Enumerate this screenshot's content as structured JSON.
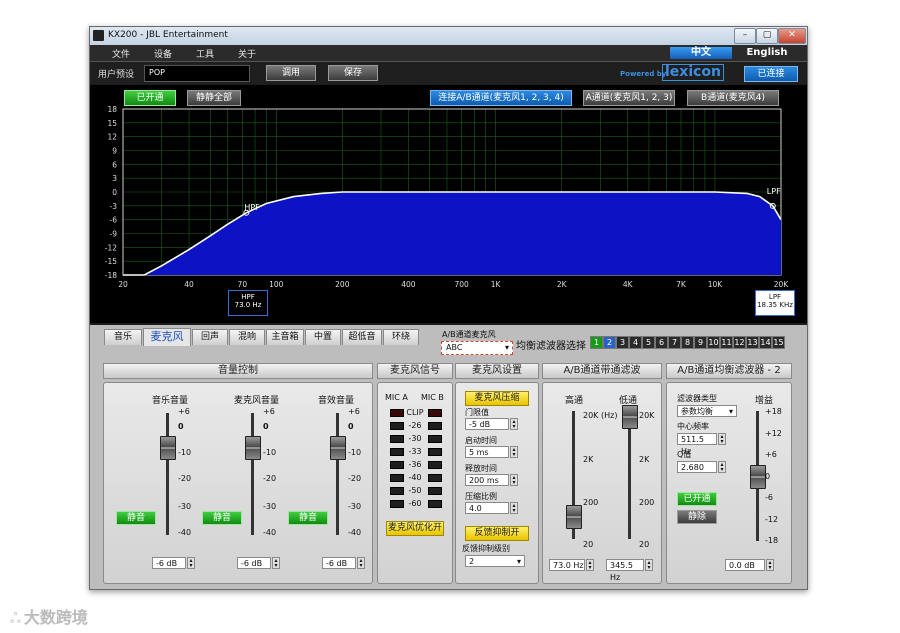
{
  "window": {
    "title": "KX200 - JBL Entertainment",
    "controls": {
      "minimize": "–",
      "maximize": "▢",
      "close": "✕"
    }
  },
  "menu": [
    "文件",
    "设备",
    "工具",
    "关于"
  ],
  "lang": {
    "zh": "中文",
    "en": "English"
  },
  "preset": {
    "label": "用户预设",
    "value": "POP",
    "recall": "调用",
    "save": "保存"
  },
  "brand": {
    "powered": "Powered by",
    "logo": "lexicon"
  },
  "connection": "已连接",
  "graph": {
    "on_button": "已开通",
    "bypass_button": "静静全部",
    "route_buttons": [
      "连接A/B通道(麦克风1, 2, 3, 4)",
      "A通道(麦克风1, 2, 3)",
      "B通道(麦克风4)"
    ],
    "hpf_label": "HPF",
    "lpf_label": "LPF",
    "hpf_box": {
      "title": "HPF",
      "value": "73.0 Hz"
    },
    "lpf_box": {
      "title": "LPF",
      "value": "18.35 KHz"
    }
  },
  "chart_data": {
    "type": "area",
    "y_ticks": [
      18,
      15,
      12,
      9,
      6,
      3,
      0,
      -3,
      -6,
      -9,
      -12,
      -15,
      -18
    ],
    "x_ticks": [
      "20",
      "40",
      "70",
      "100",
      "200",
      "400",
      "700",
      "1K",
      "2K",
      "4K",
      "7K",
      "10K",
      "20K"
    ],
    "x_tick_values": [
      20,
      40,
      70,
      100,
      200,
      400,
      700,
      1000,
      2000,
      4000,
      7000,
      10000,
      20000
    ],
    "xlim": [
      20,
      20000
    ],
    "ylim": [
      -18,
      18
    ],
    "x_scale": "log",
    "grid": true,
    "series": [
      {
        "x": [
          20,
          25,
          30,
          40,
          50,
          60,
          73,
          90,
          120,
          160,
          200,
          400,
          1000,
          4000,
          10000,
          14000,
          16000,
          18350,
          20000
        ],
        "y": [
          -20,
          -18,
          -16,
          -12.5,
          -9.5,
          -7,
          -4.5,
          -2.5,
          -1,
          -0.3,
          0,
          0,
          0,
          0,
          0,
          -0.3,
          -1,
          -3,
          -6
        ]
      }
    ],
    "color": "#0b13c4"
  },
  "tabs": [
    "音乐",
    "麦克风",
    "回声",
    "混响",
    "主音箱",
    "中置",
    "超低音",
    "环绕"
  ],
  "ab_select": {
    "label": "A/B通道麦克风",
    "value": "ABC"
  },
  "eq_select_label": "均衡滤波器选择",
  "eq_channels": [
    "1",
    "2",
    "3",
    "4",
    "5",
    "6",
    "7",
    "8",
    "9",
    "10",
    "11",
    "12",
    "13",
    "14",
    "15"
  ],
  "sections": {
    "volume": "音量控制",
    "mic_signal": "麦克风信号",
    "mic_settings": "麦克风设置",
    "bandpass": "A/B通道带通滤波",
    "peq": "A/B通道均衡滤波器 - 2"
  },
  "volume": {
    "faders": [
      {
        "label": "音乐音量",
        "mute": "静音",
        "value": "-6 dB"
      },
      {
        "label": "麦克风音量",
        "mute": "静音",
        "value": "-6 dB"
      },
      {
        "label": "音效音量",
        "mute": "静音",
        "value": "-6 dB"
      }
    ],
    "scale": [
      "+6",
      "0",
      "-10",
      "-20",
      "-30",
      "-40"
    ]
  },
  "meter": {
    "headers": [
      "MIC A",
      "MIC B"
    ],
    "levels": [
      "CLIP",
      "-26",
      "-30",
      "-33",
      "-36",
      "-40",
      "-50",
      "-60"
    ],
    "button": "麦克风优化开"
  },
  "mic_settings": {
    "compress_button": "麦克风压缩",
    "threshold": {
      "label": "门限值",
      "value": "-5 dB"
    },
    "attack": {
      "label": "启动时间",
      "value": "5 ms"
    },
    "release": {
      "label": "释放时间",
      "value": "200 ms"
    },
    "ratio": {
      "label": "压缩比例",
      "value": "4.0"
    },
    "feedback_button": "反馈抑制开",
    "feedback_level": {
      "label": "反馈抑制级别",
      "value": "2"
    }
  },
  "bandpass": {
    "hp_label": "高通",
    "lp_label": "低通",
    "hz_label": "(Hz)",
    "scale": [
      "20K",
      "2K",
      "200",
      "20"
    ],
    "hp_value": "73.0 Hz",
    "lp_value": "345.5 Hz"
  },
  "peq": {
    "type_label": "滤波器类型",
    "type_value": "参数均衡",
    "freq_label": "中心频率",
    "freq_value": "511.5 Hz",
    "q_label": "Q值",
    "q_value": "2.680",
    "on_button": "已开通",
    "bypass_button": "静除",
    "gain_label": "增益",
    "gain_scale": [
      "+18",
      "+12",
      "+6",
      "0",
      "-6",
      "-12",
      "-18"
    ],
    "gain_value": "0.0 dB"
  },
  "watermark": "大数跨境"
}
